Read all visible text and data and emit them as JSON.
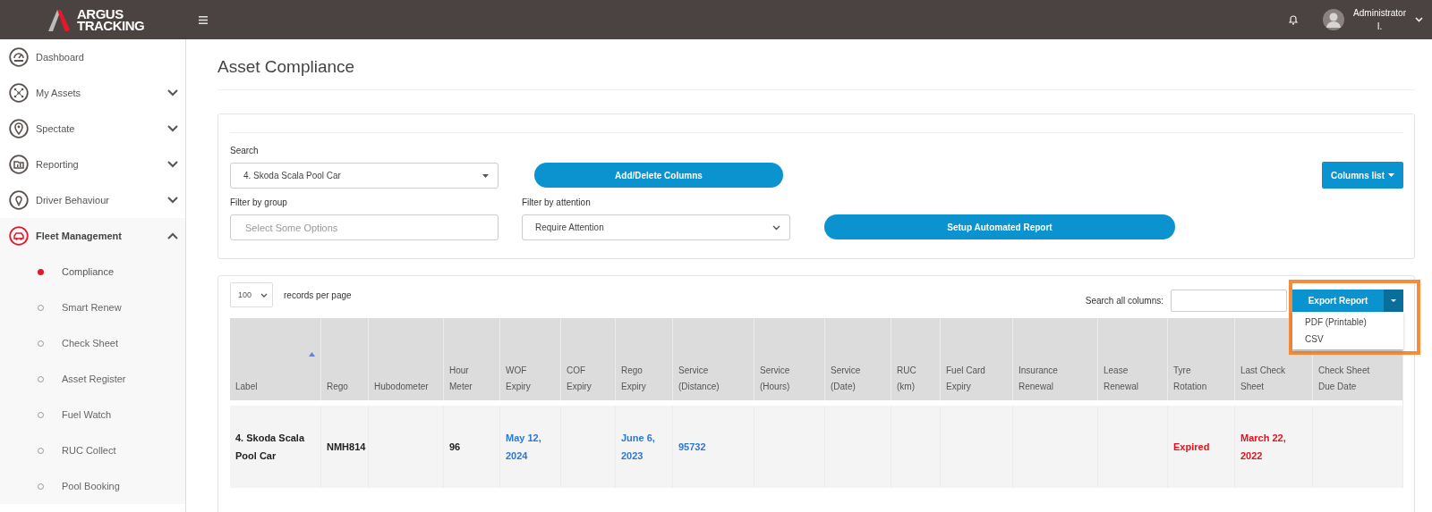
{
  "header": {
    "logo": {
      "line1": "ARGUS",
      "line2": "TRACKING"
    },
    "user": {
      "name": "Administrator",
      "subtitle": "I."
    }
  },
  "sidebar": {
    "items": [
      {
        "label": "Dashboard",
        "selected": false
      },
      {
        "label": "My Assets",
        "selected": false,
        "expanded": false
      },
      {
        "label": "Spectate",
        "selected": false,
        "expanded": false
      },
      {
        "label": "Reporting",
        "selected": false,
        "expanded": false
      },
      {
        "label": "Driver Behaviour",
        "selected": false,
        "expanded": false
      },
      {
        "label": "Fleet Management",
        "selected": true,
        "expanded": true,
        "children": [
          {
            "label": "Compliance",
            "selected": true
          },
          {
            "label": "Smart Renew",
            "selected": false
          },
          {
            "label": "Check Sheet",
            "selected": false
          },
          {
            "label": "Asset Register",
            "selected": false
          },
          {
            "label": "Fuel Watch",
            "selected": false
          },
          {
            "label": "RUC Collect",
            "selected": false
          },
          {
            "label": "Pool Booking",
            "selected": false
          }
        ]
      }
    ]
  },
  "page_title": "Asset Compliance",
  "filters": {
    "search": {
      "label": "Search",
      "value": "4. Skoda Scala Pool Car"
    },
    "add_delete_button": "Add/Delete Columns",
    "columns_list_button": "Columns list",
    "filter_by_group": {
      "label": "Filter by group",
      "placeholder": "Select Some Options"
    },
    "filter_by_attention": {
      "label": "Filter by attention",
      "value": "Require Attention"
    },
    "setup_button": "Setup Automated Report"
  },
  "table_toolbar": {
    "page_size": "100",
    "records_label": "records per page",
    "search_label": "Search all columns:",
    "export_button": "Export Report",
    "export_menu": [
      "PDF (Printable)",
      "CSV"
    ]
  },
  "table": {
    "columns": [
      {
        "label": "Label",
        "sorted": true
      },
      {
        "label": "Rego",
        "sorted": false
      },
      {
        "label": "Hubodometer",
        "sorted": false
      },
      {
        "label": "Hour Meter",
        "sorted": false
      },
      {
        "label": "WOF Expiry",
        "sorted": false
      },
      {
        "label": "COF Expiry",
        "sorted": false
      },
      {
        "label": "Rego Expiry",
        "sorted": false
      },
      {
        "label": "Service (Distance)",
        "sorted": false
      },
      {
        "label": "Service (Hours)",
        "sorted": false
      },
      {
        "label": "Service (Date)",
        "sorted": false
      },
      {
        "label": "RUC (km)",
        "sorted": false
      },
      {
        "label": "Fuel Card Expiry",
        "sorted": false
      },
      {
        "label": "Insurance Renewal",
        "sorted": false
      },
      {
        "label": "Lease Renewal",
        "sorted": false
      },
      {
        "label": "Tyre Rotation",
        "sorted": false
      },
      {
        "label": "Last Check Sheet",
        "sorted": false
      },
      {
        "label": "Check Sheet Due Date",
        "sorted": false
      }
    ],
    "rows": [
      {
        "cells": [
          {
            "text": "4. Skoda Scala Pool Car",
            "color": "#222222"
          },
          {
            "text": "NMH814",
            "color": "#222222"
          },
          null,
          {
            "text": "96",
            "color": "#222222"
          },
          {
            "text": "May 12, 2024",
            "color": "#2a78d8"
          },
          null,
          {
            "text": "June 6, 2023",
            "color": "#2a78d8"
          },
          {
            "text": "95732",
            "color": "#2a78d8"
          },
          null,
          null,
          null,
          null,
          null,
          null,
          {
            "text": "Expired",
            "color": "#e8101a"
          },
          {
            "text": "March 22, 2022",
            "color": "#e8101a"
          },
          null
        ]
      }
    ]
  }
}
